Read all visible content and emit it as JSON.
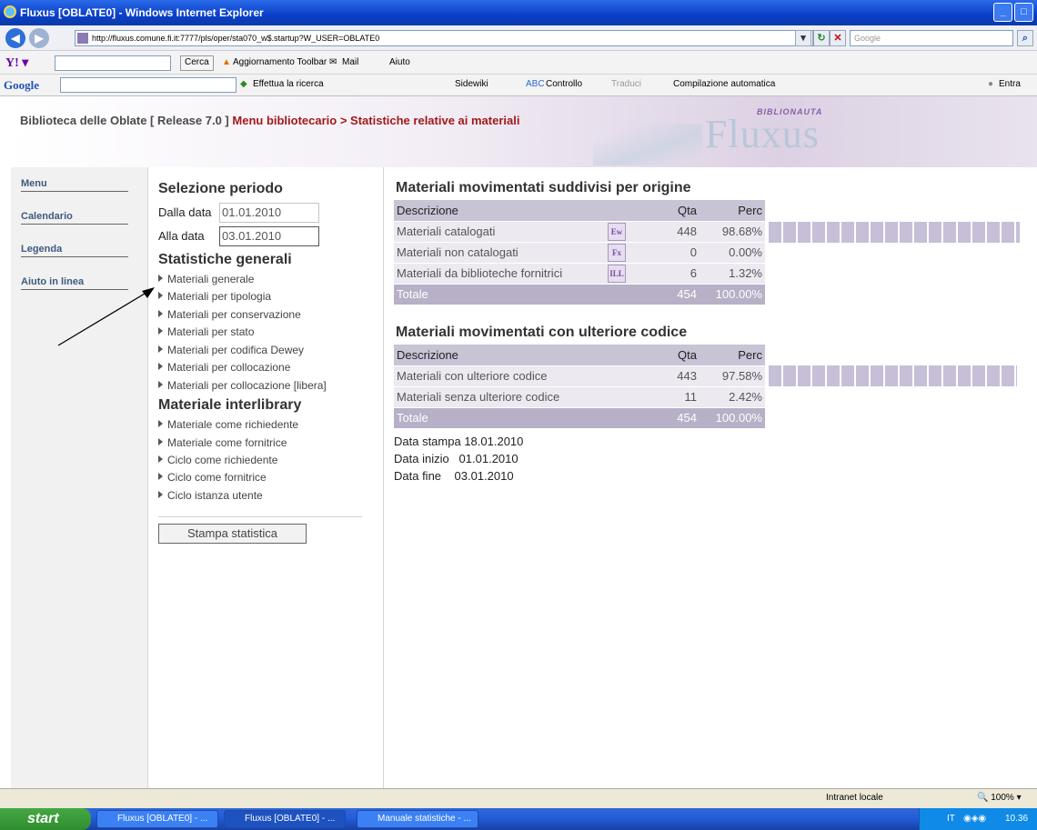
{
  "browser": {
    "window_title": "Fluxus [OBLATE0] - Windows Internet Explorer",
    "url": "http://fluxus.comune.fi.it:7777/pls/oper/sta070_w$.startup?W_USER=OBLATE0",
    "search_placeholder": "Google",
    "yahoo_toolbar": {
      "cerca_label": "Cerca",
      "update_label": "Aggiornamento Toolbar",
      "mail_label": "Mail",
      "help_label": "Aiuto"
    },
    "google_toolbar": {
      "logo": "Google",
      "search_label": "Effettua la ricerca",
      "sidewiki_label": "Sidewiki",
      "check_label": "Controllo",
      "translate_label": "Traduci",
      "autofill_label": "Compilazione automatica",
      "signin_label": "Entra"
    },
    "status": {
      "zone": "Intranet locale",
      "zoom": "100%"
    }
  },
  "header": {
    "prefix": "Biblioteca delle Oblate [ Release 7.0 ]",
    "path": "Menu bibliotecario > Statistiche relative ai materiali",
    "logo": "Fluxus",
    "logo_sub": "BIBLIONAUTA"
  },
  "nav": [
    "Menu",
    "Calendario",
    "Legenda",
    "Aiuto in linea"
  ],
  "period": {
    "title": "Selezione periodo",
    "from_label": "Dalla data",
    "from_value": "01.01.2010",
    "to_label": "Alla data",
    "to_value": "03.01.2010"
  },
  "general": {
    "title": "Statistiche generali",
    "links": [
      "Materiali generale",
      "Materiali per tipologia",
      "Materiali per conservazione",
      "Materiali per stato",
      "Materiali per codifica Dewey",
      "Materiali per collocazione",
      "Materiali per collocazione [libera]"
    ]
  },
  "interlibrary": {
    "title": "Materiale interlibrary",
    "links": [
      "Materiale come richiedente",
      "Materiale come fornitrice",
      "Ciclo come richiedente",
      "Ciclo come fornitrice",
      "Ciclo istanza utente"
    ]
  },
  "print_button": "Stampa statistica",
  "table1": {
    "title": "Materiali movimentati suddivisi per origine",
    "headers": [
      "Descrizione",
      "Qta",
      "Perc"
    ],
    "rows": [
      {
        "desc": "Materiali catalogati",
        "icon": "Ew",
        "qta": "448",
        "perc": "98.68%",
        "pct": 98.68
      },
      {
        "desc": "Materiali non catalogati",
        "icon": "Fx",
        "qta": "0",
        "perc": "0.00%",
        "pct": 0
      },
      {
        "desc": "Materiali da biblioteche fornitrici",
        "icon": "ILL",
        "qta": "6",
        "perc": "1.32%",
        "pct": 1.32
      }
    ],
    "total": {
      "label": "Totale",
      "qta": "454",
      "perc": "100.00%"
    }
  },
  "table2": {
    "title": "Materiali movimentati con ulteriore codice",
    "headers": [
      "Descrizione",
      "Qta",
      "Perc"
    ],
    "rows": [
      {
        "desc": "Materiali con ulteriore codice",
        "qta": "443",
        "perc": "97.58%",
        "pct": 97.58
      },
      {
        "desc": "Materiali senza ulteriore codice",
        "qta": "11",
        "perc": "2.42%",
        "pct": 2.42
      }
    ],
    "total": {
      "label": "Totale",
      "qta": "454",
      "perc": "100.00%"
    }
  },
  "info": {
    "print_label": "Data stampa",
    "print_value": "18.01.2010",
    "start_label": "Data inizio",
    "start_value": "01.01.2010",
    "end_label": "Data fine",
    "end_value": "03.01.2010"
  },
  "taskbar": {
    "start": "start",
    "tasks": [
      "Fluxus [OBLATE0] - ...",
      "Fluxus [OBLATE0] - ...",
      "Manuale statistiche - ..."
    ],
    "lang": "IT",
    "clock": "10.36"
  }
}
